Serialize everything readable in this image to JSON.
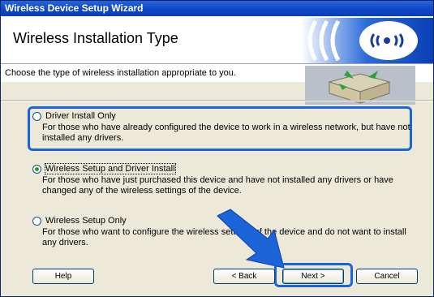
{
  "window": {
    "title": "Wireless Device Setup Wizard"
  },
  "header": {
    "title": "Wireless Installation Type"
  },
  "subheader": {
    "text": "Choose the type of wireless installation appropriate to you."
  },
  "options": [
    {
      "label": "Driver Install Only",
      "description": "For those who have already configured the device to work in a wireless network, but have not installed any drivers.",
      "checked": false
    },
    {
      "label": "Wireless Setup and Driver Install",
      "description": "For those who have just purchased this device and have not installed any drivers or have changed any of the wireless settings of the device.",
      "checked": true
    },
    {
      "label": "Wireless Setup Only",
      "description": "For those who want to configure the wireless settings of the device and do not want to install any drivers.",
      "checked": false
    }
  ],
  "buttons": {
    "help": "Help",
    "back": "< Back",
    "next": "Next >",
    "cancel": "Cancel"
  },
  "colors": {
    "accent": "#1c64d8",
    "titlebar": "#0b46c4"
  }
}
